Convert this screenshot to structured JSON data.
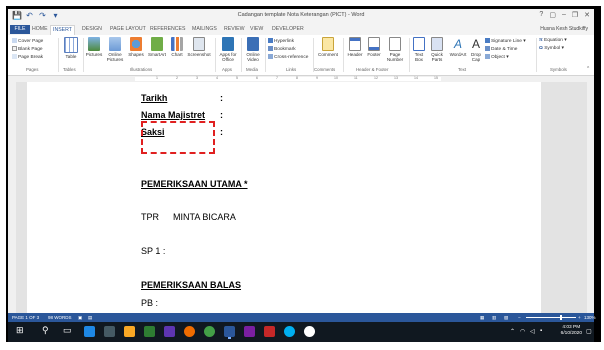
{
  "window": {
    "title": "Cadangan template Nota Keterangan (PICT) - Word",
    "controls": [
      "?",
      "▢",
      "–",
      "❐",
      "✕"
    ]
  },
  "quick_access": [
    "💾",
    "↶",
    "↷",
    "▾"
  ],
  "ribbon_tabs": [
    "FILE",
    "HOME",
    "INSERT",
    "DESIGN",
    "PAGE LAYOUT",
    "REFERENCES",
    "MAILINGS",
    "REVIEW",
    "VIEW",
    "DEVELOPER"
  ],
  "active_tab": "INSERT",
  "user": "Husna Kesh Studkiffy",
  "ribbon": {
    "pages": [
      "Cover Page",
      "Blank Page",
      "Page Break"
    ],
    "buttons": {
      "table": "Table",
      "pictures": "Pictures",
      "online_pictures": "Online Pictures",
      "shapes": "Shapes",
      "smartart": "SmartArt",
      "chart": "Chart",
      "screenshot": "Screenshot",
      "apps": "Apps for Office",
      "online_video": "Online Video",
      "comment": "Comment",
      "header": "Header",
      "footer": "Footer",
      "page_number": "Page Number",
      "text_box": "Text Box",
      "quick_parts": "Quick Parts",
      "wordart": "WordArt",
      "drop_cap": "Drop Cap"
    },
    "links": [
      "Hyperlink",
      "Bookmark",
      "Cross-reference"
    ],
    "text_small": [
      "Signature Line",
      "Date & Time",
      "Object"
    ],
    "symbols": [
      "Equation",
      "Symbol"
    ],
    "groups": [
      "Pages",
      "Tables",
      "Illustrations",
      "Apps",
      "Media",
      "Links",
      "Comments",
      "Header & Footer",
      "Text",
      "Symbols"
    ]
  },
  "ruler_numbers": [
    "1",
    "2",
    "3",
    "4",
    "5",
    "6",
    "7",
    "8",
    "9",
    "10",
    "11",
    "12",
    "13",
    "14",
    "15"
  ],
  "document": {
    "lines": [
      {
        "label": "Tarikh",
        "colon": ":"
      },
      {
        "label": "Nama Majistret",
        "colon": ":"
      },
      {
        "label": "Saksi",
        "colon": ":"
      }
    ],
    "heading1": "PEMERIKSAAN UTAMA *",
    "tpr_label": "TPR",
    "tpr_value": "MINTA BICARA",
    "sp1": "SP 1   :",
    "heading2": "PEMERIKSAAN BALAS",
    "pb": "PB     :"
  },
  "statusbar": {
    "page": "PAGE 1 OF 3",
    "words": "98 WORDS",
    "zoom": "130%"
  },
  "taskbar": {
    "time": "4:03 PM",
    "date": "6/10/2020"
  },
  "colors": {
    "word_blue": "#2b579a",
    "highlight_red": "#e02020"
  }
}
